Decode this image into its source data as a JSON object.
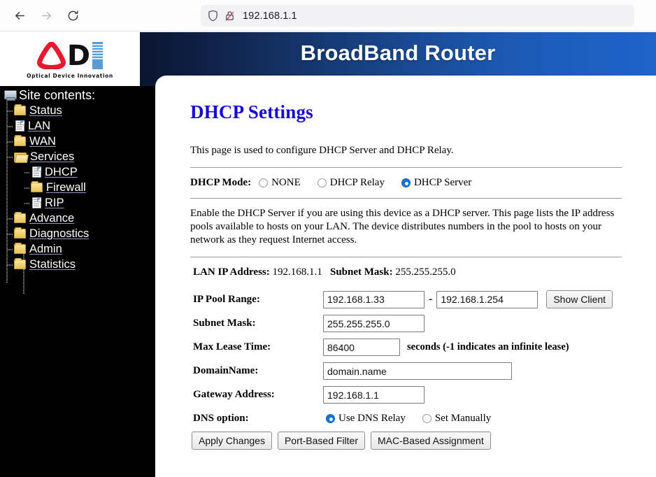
{
  "browser": {
    "back_label": "Back",
    "forward_label": "Forward",
    "reload_label": "Reload",
    "shield_icon": "shield-icon",
    "insecure_icon": "padlock-crossed-icon",
    "url": "192.168.1.1"
  },
  "logo": {
    "letter_d": "D",
    "tagline": "Optical Device Innovation",
    "red": "#e8192c",
    "blue": "#5b9bd5"
  },
  "header": {
    "title": "BroadBand Router"
  },
  "sidebar": {
    "root_label": "Site contents:",
    "items": [
      {
        "label": "Status",
        "icon": "folder-icon",
        "level": 1
      },
      {
        "label": "LAN",
        "icon": "page-icon",
        "level": 1
      },
      {
        "label": "WAN",
        "icon": "folder-icon",
        "level": 1
      },
      {
        "label": "Services",
        "icon": "folder-open-icon",
        "level": 1
      },
      {
        "label": "DHCP",
        "icon": "page-icon",
        "level": 2
      },
      {
        "label": "Firewall",
        "icon": "folder-icon",
        "level": 2
      },
      {
        "label": "RIP",
        "icon": "page-icon",
        "level": 2
      },
      {
        "label": "Advance",
        "icon": "folder-icon",
        "level": 1
      },
      {
        "label": "Diagnostics",
        "icon": "folder-icon",
        "level": 1
      },
      {
        "label": "Admin",
        "icon": "folder-icon",
        "level": 1
      },
      {
        "label": "Statistics",
        "icon": "folder-icon",
        "level": 1
      }
    ]
  },
  "main": {
    "page_title": "DHCP Settings",
    "intro": "This page is used to configure DHCP Server and DHCP Relay.",
    "mode_label": "DHCP Mode:",
    "mode_options": [
      {
        "label": "NONE",
        "selected": false
      },
      {
        "label": "DHCP Relay",
        "selected": false
      },
      {
        "label": "DHCP Server",
        "selected": true
      }
    ],
    "description": "Enable the DHCP Server if you are using this device as a DHCP server. This page lists the IP address pools available to hosts on your LAN. The device distributes numbers in the pool to hosts on your network as they request Internet access.",
    "lan_ip_label": "LAN IP Address:",
    "lan_ip_value": "192.168.1.1",
    "lan_mask_label": "Subnet Mask:",
    "lan_mask_value": "255.255.255.0",
    "fields": {
      "pool_label": "IP Pool Range:",
      "pool_start": "192.168.1.33",
      "pool_dash": "-",
      "pool_end": "192.168.1.254",
      "show_client_label": "Show Client",
      "mask_label": "Subnet Mask:",
      "mask_value": "255.255.255.0",
      "lease_label": "Max Lease Time:",
      "lease_value": "86400",
      "lease_hint": "seconds (-1 indicates an infinite lease)",
      "domain_label": "DomainName:",
      "domain_value": "domain.name",
      "gateway_label": "Gateway Address:",
      "gateway_value": "192.168.1.1"
    },
    "dns_label": "DNS option:",
    "dns_options": [
      {
        "label": "Use DNS Relay",
        "selected": true
      },
      {
        "label": "Set Manually",
        "selected": false
      }
    ],
    "buttons": [
      {
        "label": "Apply Changes"
      },
      {
        "label": "Port-Based Filter"
      },
      {
        "label": "MAC-Based Assignment"
      }
    ]
  }
}
